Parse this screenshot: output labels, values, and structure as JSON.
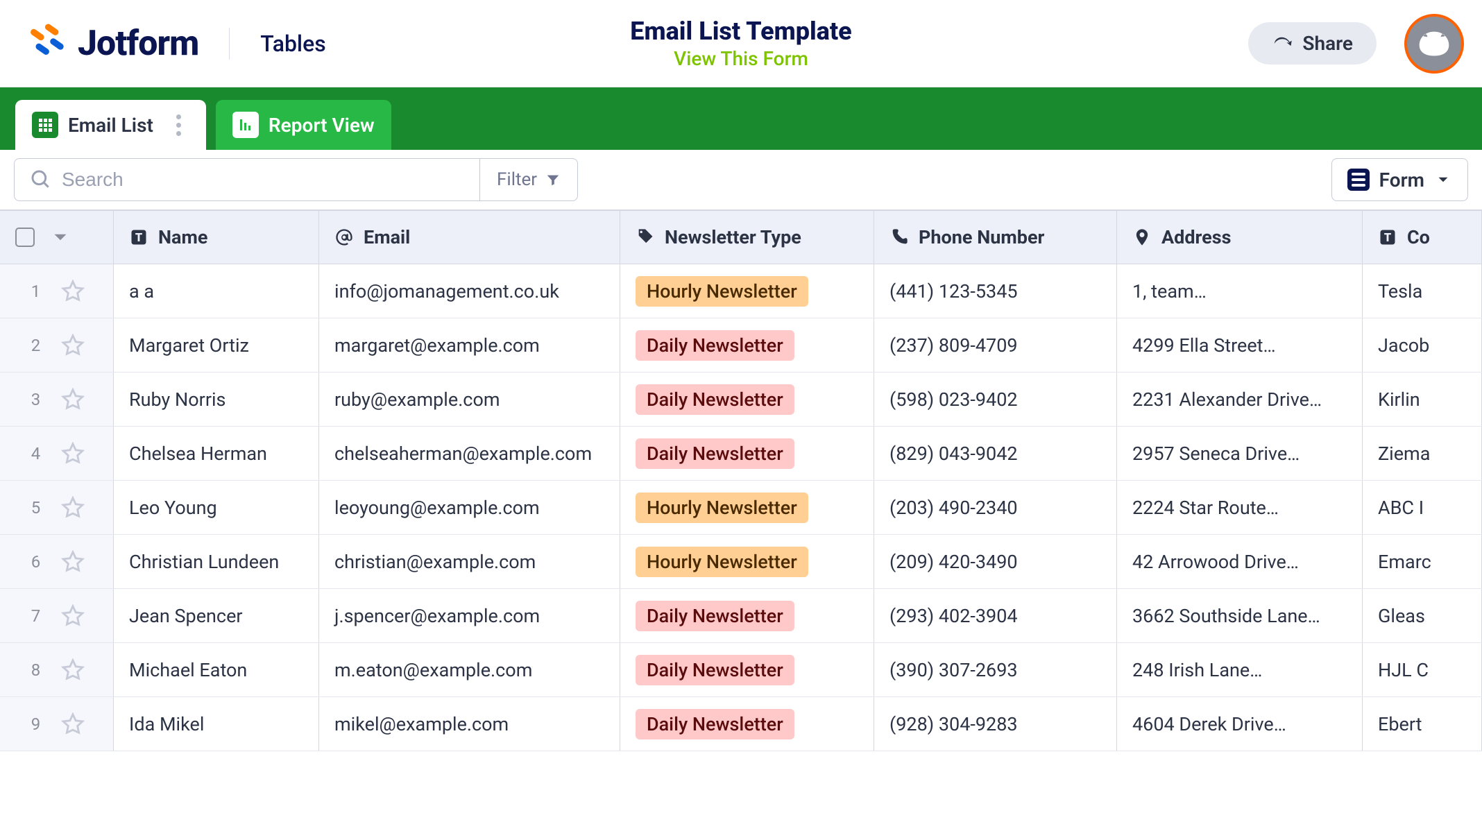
{
  "header": {
    "brand_primary": "Jotform",
    "brand_secondary": "Tables",
    "title": "Email List Template",
    "subtitle_link": "View This Form",
    "share_label": "Share"
  },
  "tabs": {
    "active": {
      "label": "Email List"
    },
    "inactive": {
      "label": "Report View"
    }
  },
  "toolbar": {
    "search_placeholder": "Search",
    "filter_label": "Filter",
    "form_label": "Form"
  },
  "columns": {
    "name": "Name",
    "email": "Email",
    "type": "Newsletter Type",
    "phone": "Phone Number",
    "address": "Address",
    "company": "Co"
  },
  "newsletter_types": {
    "hourly": "Hourly Newsletter",
    "daily": "Daily Newsletter"
  },
  "rows": [
    {
      "n": "1",
      "name": "a a",
      "email": "info@jomanagement.co.uk",
      "type": "hourly",
      "phone": "(441) 123-5345",
      "address": "1, team",
      "company": "Tesla"
    },
    {
      "n": "2",
      "name": "Margaret Ortiz",
      "email": "margaret@example.com",
      "type": "daily",
      "phone": "(237) 809-4709",
      "address": "4299 Ella Street",
      "company": "Jacob"
    },
    {
      "n": "3",
      "name": "Ruby Norris",
      "email": "ruby@example.com",
      "type": "daily",
      "phone": "(598) 023-9402",
      "address": "2231 Alexander Drive",
      "company": "Kirlin"
    },
    {
      "n": "4",
      "name": "Chelsea Herman",
      "email": "chelseaherman@example.com",
      "type": "daily",
      "phone": "(829) 043-9042",
      "address": "2957 Seneca Drive",
      "company": "Ziema"
    },
    {
      "n": "5",
      "name": "Leo Young",
      "email": "leoyoung@example.com",
      "type": "hourly",
      "phone": "(203) 490-2340",
      "address": "2224 Star Route",
      "company": "ABC I"
    },
    {
      "n": "6",
      "name": "Christian Lundeen",
      "email": "christian@example.com",
      "type": "hourly",
      "phone": "(209) 420-3490",
      "address": "42 Arrowood Drive",
      "company": "Emarc"
    },
    {
      "n": "7",
      "name": "Jean Spencer",
      "email": "j.spencer@example.com",
      "type": "daily",
      "phone": "(293) 402-3904",
      "address": "3662 Southside Lane",
      "company": "Gleas"
    },
    {
      "n": "8",
      "name": "Michael Eaton",
      "email": "m.eaton@example.com",
      "type": "daily",
      "phone": "(390) 307-2693",
      "address": "248 Irish Lane",
      "company": "HJL C"
    },
    {
      "n": "9",
      "name": "Ida Mikel",
      "email": "mikel@example.com",
      "type": "daily",
      "phone": "(928) 304-9283",
      "address": "4604 Derek Drive",
      "company": "Ebert"
    }
  ]
}
